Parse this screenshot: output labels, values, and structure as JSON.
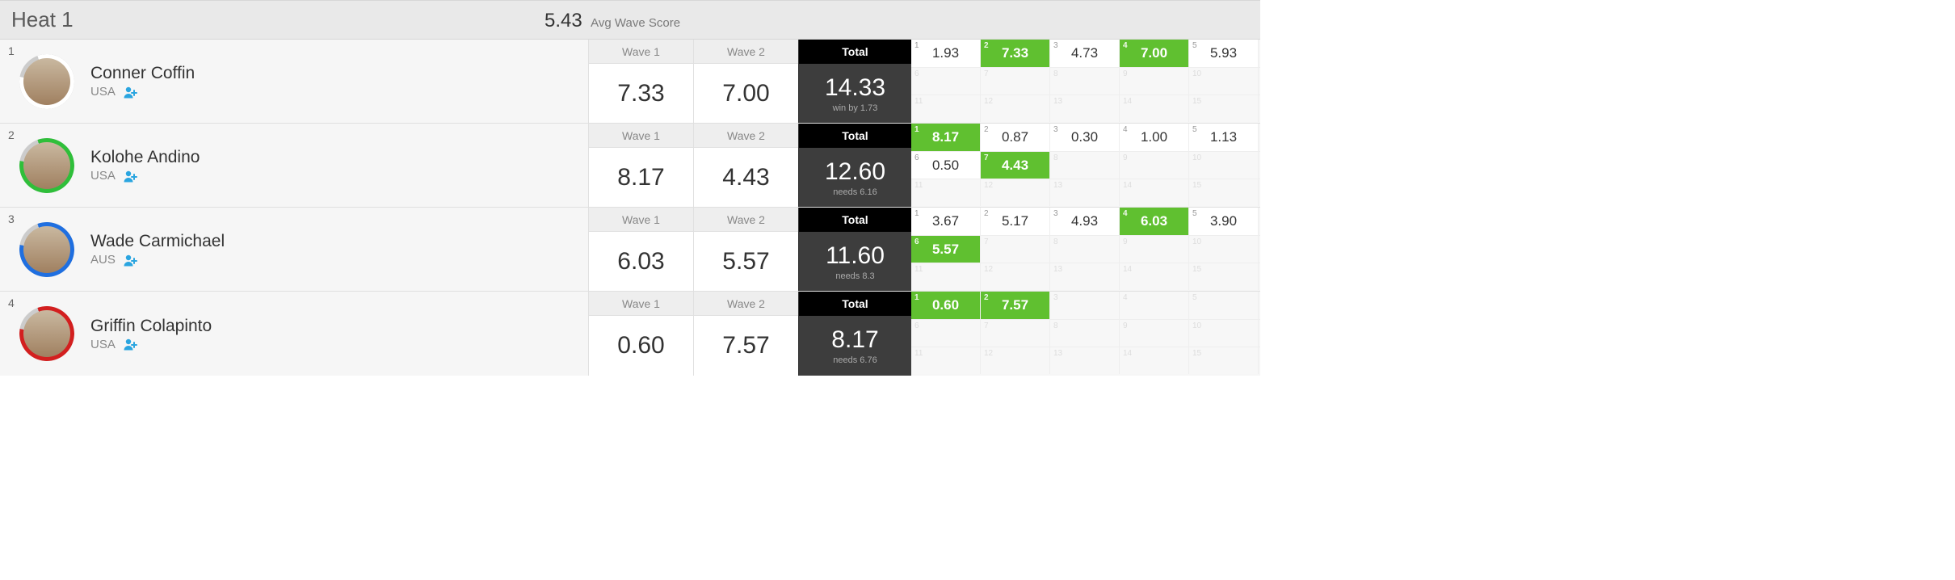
{
  "header": {
    "title": "Heat 1",
    "avg_value": "5.43",
    "avg_label": "Avg Wave Score"
  },
  "labels": {
    "wave1": "Wave 1",
    "wave2": "Wave 2",
    "total": "Total"
  },
  "colors": {
    "highlight": "#60c030",
    "total_bg": "#3d3d3d",
    "total_header": "#000000"
  },
  "ring_colors": [
    "#ffffff",
    "#2fbf3a",
    "#1f6fe0",
    "#d31f1f"
  ],
  "athletes": [
    {
      "rank": "1",
      "name": "Conner Coffin",
      "country": "USA",
      "wave1": "7.33",
      "wave2": "7.00",
      "total": "14.33",
      "sub": "win by 1.73",
      "waves": [
        {
          "idx": "1",
          "val": "1.93",
          "hl": false
        },
        {
          "idx": "2",
          "val": "7.33",
          "hl": true
        },
        {
          "idx": "3",
          "val": "4.73",
          "hl": false
        },
        {
          "idx": "4",
          "val": "7.00",
          "hl": true
        },
        {
          "idx": "5",
          "val": "5.93",
          "hl": false
        }
      ]
    },
    {
      "rank": "2",
      "name": "Kolohe Andino",
      "country": "USA",
      "wave1": "8.17",
      "wave2": "4.43",
      "total": "12.60",
      "sub": "needs 6.16",
      "waves": [
        {
          "idx": "1",
          "val": "8.17",
          "hl": true
        },
        {
          "idx": "2",
          "val": "0.87",
          "hl": false
        },
        {
          "idx": "3",
          "val": "0.30",
          "hl": false
        },
        {
          "idx": "4",
          "val": "1.00",
          "hl": false
        },
        {
          "idx": "5",
          "val": "1.13",
          "hl": false
        },
        {
          "idx": "6",
          "val": "0.50",
          "hl": false
        },
        {
          "idx": "7",
          "val": "4.43",
          "hl": true
        }
      ]
    },
    {
      "rank": "3",
      "name": "Wade Carmichael",
      "country": "AUS",
      "wave1": "6.03",
      "wave2": "5.57",
      "total": "11.60",
      "sub": "needs 8.3",
      "waves": [
        {
          "idx": "1",
          "val": "3.67",
          "hl": false
        },
        {
          "idx": "2",
          "val": "5.17",
          "hl": false
        },
        {
          "idx": "3",
          "val": "4.93",
          "hl": false
        },
        {
          "idx": "4",
          "val": "6.03",
          "hl": true
        },
        {
          "idx": "5",
          "val": "3.90",
          "hl": false
        },
        {
          "idx": "6",
          "val": "5.57",
          "hl": true
        }
      ]
    },
    {
      "rank": "4",
      "name": "Griffin Colapinto",
      "country": "USA",
      "wave1": "0.60",
      "wave2": "7.57",
      "total": "8.17",
      "sub": "needs 6.76",
      "waves": [
        {
          "idx": "1",
          "val": "0.60",
          "hl": true
        },
        {
          "idx": "2",
          "val": "7.57",
          "hl": true
        }
      ]
    }
  ]
}
